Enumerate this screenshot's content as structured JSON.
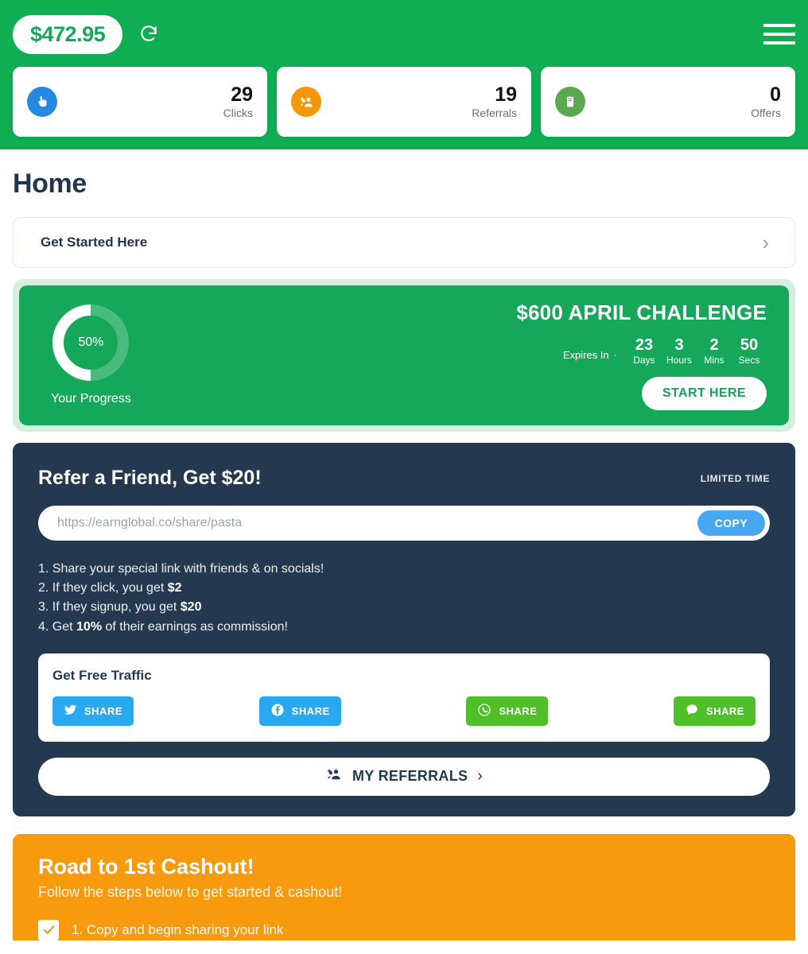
{
  "header": {
    "balance": "$472.95",
    "refresh_icon": "refresh-icon",
    "menu_icon": "hamburger-menu-icon",
    "stats": [
      {
        "icon": "click-hand-icon",
        "value": "29",
        "label": "Clicks",
        "color": "#2589E0"
      },
      {
        "icon": "add-people-icon",
        "value": "19",
        "label": "Referrals",
        "color": "#F6960B"
      },
      {
        "icon": "offers-mobile-icon",
        "value": "0",
        "label": "Offers",
        "color": "#5AA84F"
      }
    ]
  },
  "page": {
    "title": "Home"
  },
  "get_started": {
    "label": "Get Started Here",
    "chevron": "chevron-right-icon"
  },
  "challenge": {
    "progress_percent": "50%",
    "progress_value": 50,
    "progress_caption": "Your Progress",
    "title": "$600 APRIL CHALLENGE",
    "expires_label": "Expires In",
    "separator": "·",
    "countdown": [
      {
        "value": "23",
        "unit": "Days"
      },
      {
        "value": "3",
        "unit": "Hours"
      },
      {
        "value": "2",
        "unit": "Mins"
      },
      {
        "value": "50",
        "unit": "Secs"
      }
    ],
    "cta_label": "START HERE"
  },
  "refer": {
    "title": "Refer a Friend, Get $20!",
    "badge": "LIMITED TIME",
    "link_placeholder": "https://earnglobal.co/share/pasta",
    "link_value": "",
    "copy_label": "COPY",
    "steps": [
      {
        "prefix": "1. Share your special link with friends & on socials!",
        "bold": "",
        "suffix": ""
      },
      {
        "prefix": "2. If they click, you get ",
        "bold": "$2",
        "suffix": ""
      },
      {
        "prefix": "3. If they signup, you get ",
        "bold": "$20",
        "suffix": ""
      },
      {
        "prefix": "4. Get ",
        "bold": "10%",
        "suffix": " of their earnings as commission!"
      }
    ],
    "traffic_title": "Get Free Traffic",
    "share_buttons": [
      {
        "network": "twitter",
        "icon": "twitter-bird-icon",
        "label": "SHARE",
        "color": "#29A9EF"
      },
      {
        "network": "facebook",
        "icon": "facebook-f-icon",
        "label": "SHARE",
        "color": "#29A9EF"
      },
      {
        "network": "whatsapp",
        "icon": "whatsapp-icon",
        "label": "SHARE",
        "color": "#4FC028"
      },
      {
        "network": "sms",
        "icon": "message-bubble-icon",
        "label": "SHARE",
        "color": "#4FC028"
      }
    ],
    "my_referrals_label": "MY REFERRALS",
    "my_referrals_icon": "add-people-icon",
    "my_referrals_chevron": "chevron-right-icon"
  },
  "cashout": {
    "title": "Road to 1st Cashout!",
    "subtitle": "Follow the steps below to get started & cashout!",
    "steps": [
      {
        "checked": true,
        "label": "1. Copy and begin sharing your link"
      }
    ]
  },
  "colors": {
    "brand_green": "#0FAE53",
    "challenge_green": "#16A85A",
    "dark_navy": "#24384F",
    "orange": "#F79A0E",
    "blue": "#47A7F0"
  }
}
